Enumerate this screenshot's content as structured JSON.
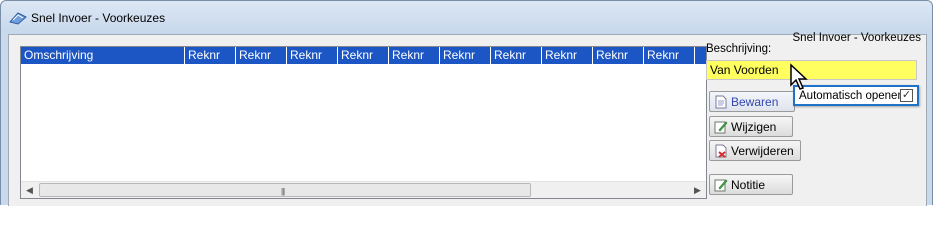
{
  "window": {
    "title": "Snel Invoer - Voorkeuzes"
  },
  "panel": {
    "title": "Snel Invoer - Voorkeuzes"
  },
  "list": {
    "columns": [
      "Omschrijving",
      "Reknr",
      "Reknr",
      "Reknr",
      "Reknr",
      "Reknr",
      "Reknr",
      "Reknr",
      "Reknr",
      "Reknr",
      "Reknr"
    ]
  },
  "form": {
    "beschrijving_label": "Beschrijving:",
    "beschrijving_value": "Van Voorden",
    "automatisch_label": "Automatisch openen",
    "automatisch_checked": true
  },
  "buttons": {
    "bewaren": "Bewaren",
    "wijzigen": "Wijzigen",
    "verwijderen": "Verwijderen",
    "notitie": "Notitie"
  },
  "colors": {
    "header_blue": "#1c55c4",
    "input_yellow": "#ffff60",
    "highlight_border": "#1e73c8"
  }
}
